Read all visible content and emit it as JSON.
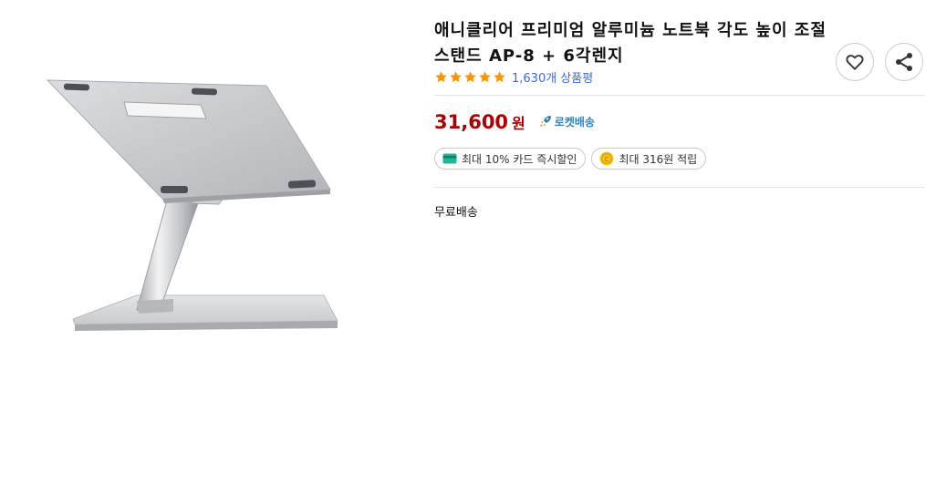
{
  "product": {
    "title": "애니클리어 프리미엄 알루미늄 노트북 각도 높이 조절 스탠드 AP-8 + 6각렌지",
    "rating": 5,
    "review_count": "1,630개 상품평",
    "price": "31,600",
    "price_unit": "원",
    "delivery_badge": "로켓배송",
    "benefits": [
      {
        "label": "최대 10% 카드 즉시할인",
        "icon": "card-icon"
      },
      {
        "label": "최대 316원 적립",
        "icon": "coin-icon"
      }
    ],
    "shipping": "무료배송"
  },
  "actions": {
    "wishlist_icon": "heart-icon",
    "share_icon": "share-icon"
  },
  "colors": {
    "price": "#ae0000",
    "star": "#ff9600",
    "link": "#346aff",
    "rocket": "#2b84c7"
  }
}
